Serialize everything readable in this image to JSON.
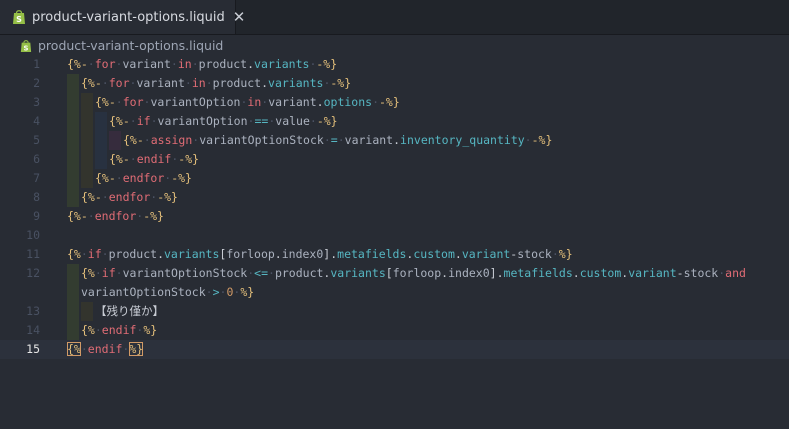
{
  "tab": {
    "label": "product-variant-options.liquid",
    "close_glyph": "✕",
    "icon": "shopify-bag-icon"
  },
  "breadcrumb": {
    "label": "product-variant-options.liquid",
    "icon": "shopify-bag-icon"
  },
  "editor": {
    "current_line": 15,
    "lines": [
      {
        "n": "1",
        "text": "{%- for variant in product.variants -%}"
      },
      {
        "n": "2",
        "text": "{%- for variant in product.variants -%}"
      },
      {
        "n": "3",
        "text": "{%- for variantOption in variant.options -%}"
      },
      {
        "n": "4",
        "text": "{%- if variantOption == value -%}"
      },
      {
        "n": "5",
        "text": "{%- assign variantOptionStock = variant.inventory_quantity -%}"
      },
      {
        "n": "6",
        "text": "{%- endif -%}"
      },
      {
        "n": "7",
        "text": "{%- endfor -%}"
      },
      {
        "n": "8",
        "text": "{%- endfor -%}"
      },
      {
        "n": "9",
        "text": "{%- endfor -%}"
      },
      {
        "n": "10",
        "text": ""
      },
      {
        "n": "11",
        "text": "{% if product.variants[forloop.index0].metafields.custom.variant-stock %}"
      },
      {
        "n": "12",
        "text": "{% if variantOptionStock <= product.variants[forloop.index0].metafields.custom.variant-stock and"
      },
      {
        "n": "",
        "text": "variantOptionStock > 0 %}"
      },
      {
        "n": "13",
        "text": "【残り僅か】"
      },
      {
        "n": "14",
        "text": "{% endif %}"
      },
      {
        "n": "15",
        "text": "{% endif %}"
      }
    ]
  },
  "colors": {
    "background": "#282c34",
    "tab_bar": "#21252b",
    "delimiter": "#e5c07b",
    "keyword": "#e06c75",
    "property": "#56b6c2",
    "number": "#d19a66"
  }
}
